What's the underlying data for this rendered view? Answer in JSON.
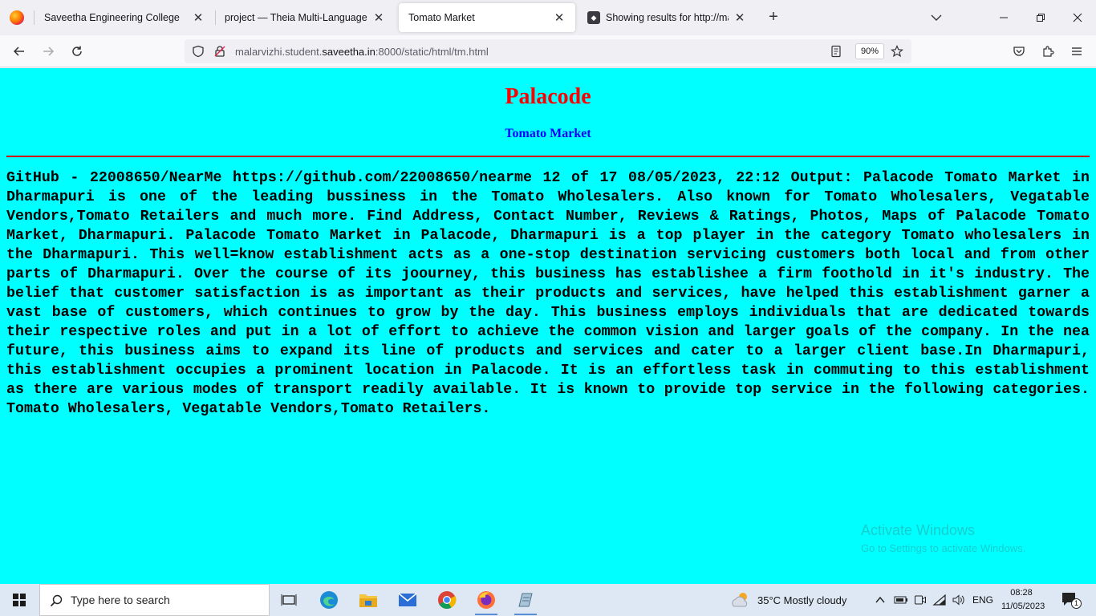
{
  "browser": {
    "tabs": [
      {
        "title": "Saveetha Engineering College",
        "active": false
      },
      {
        "title": "project — Theia Multi-Language Ex",
        "active": false
      },
      {
        "title": "Tomato Market",
        "active": true
      },
      {
        "title": "Showing results for http://malar",
        "active": false
      }
    ],
    "url_prefix": "malarvizhi.student.",
    "url_host": "saveetha.in",
    "url_suffix": ":8000/static/html/tm.html",
    "zoom": "90%"
  },
  "page": {
    "heading": "Palacode",
    "subheading": "Tomato Market",
    "body": "GitHub - 22008650/NearMe https://github.com/22008650/nearme 12 of 17 08/05/2023, 22:12 Output: Palacode Tomato Market in Dharmapuri is one of the leading bussiness in the Tomato Wholesalers. Also known for Tomato Wholesalers, Vegatable Vendors,Tomato Retailers and much more. Find Address, Contact Number, Reviews & Ratings, Photos, Maps of Palacode Tomato Market, Dharmapuri. Palacode Tomato Market in Palacode, Dharmapuri is a top player in the category Tomato wholesalers in the Dharmapuri. This well=know establishment acts as a one-stop destination servicing customers both local and from other parts of Dharmapuri. Over the course of its joourney, this business has establishee a firm foothold in it's industry. The belief that customer satisfaction is as important as their products and services, have helped this establishment garner a vast base of customers, which continues to grow by the day. This business employs individuals that are dedicated towards their respective roles and put in a lot of effort to achieve the common vision and larger goals of the company. In the nea future, this business aims to expand its line of products and services and cater to a larger client base.In Dharmapuri, this establishment occupies a prominent location in Palacode. It is an effortless task in commuting to this establishment as there are various modes of transport readily available. It is known to provide top service in the following categories. Tomato Wholesalers, Vegatable Vendors,Tomato Retailers.",
    "colors": {
      "background": "#00ffff",
      "heading": "#ff0000",
      "subheading": "#0000ff",
      "rule": "#cc0000"
    }
  },
  "watermark": {
    "line1": "Activate Windows",
    "line2": "Go to Settings to activate Windows."
  },
  "taskbar": {
    "search_placeholder": "Type here to search",
    "weather": "35°C  Mostly cloudy",
    "language": "ENG",
    "time": "08:28",
    "date": "11/05/2023",
    "notification_count": "1",
    "apps": [
      "task-view-icon",
      "edge-icon",
      "file-explorer-icon",
      "mail-icon",
      "chrome-icon",
      "firefox-icon",
      "notepad-icon"
    ]
  }
}
